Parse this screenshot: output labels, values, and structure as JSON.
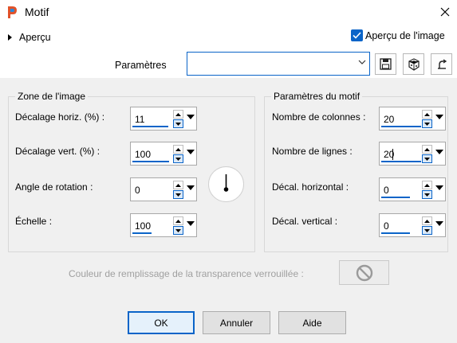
{
  "window": {
    "title": "Motif",
    "icon": "app-logo-icon",
    "close_icon": "close-icon"
  },
  "toprow": {
    "apercu_label": "Aperçu",
    "preview_checkbox_label": "Aperçu de l'image",
    "preview_checked": true,
    "parametres_label": "Paramètres",
    "parametres_value": "",
    "tools": [
      "save-icon",
      "randomize-icon",
      "reset-icon"
    ]
  },
  "zone": {
    "title": "Zone de l'image",
    "fields": [
      {
        "label": "Décalage horiz. (%) :",
        "value": "11"
      },
      {
        "label": "Décalage vert. (%) :",
        "value": "100"
      },
      {
        "label": "Angle de rotation :",
        "value": "0"
      },
      {
        "label": "Échelle :",
        "value": "100"
      }
    ]
  },
  "motif": {
    "title": "Paramètres du motif",
    "fields": [
      {
        "label": "Nombre de colonnes :",
        "value": "20"
      },
      {
        "label": "Nombre de lignes :",
        "value": "20"
      },
      {
        "label": "Décal. horizontal :",
        "value": "0"
      },
      {
        "label": "Décal. vertical :",
        "value": "0"
      }
    ]
  },
  "fill": {
    "label": "Couleur de remplissage de la transparence verrouillée :",
    "icon": "no-symbol-icon"
  },
  "buttons": {
    "ok": "OK",
    "cancel": "Annuler",
    "help": "Aide"
  },
  "colors": {
    "accent": "#0a64c8",
    "dialog_bg": "#f0f0f0"
  }
}
